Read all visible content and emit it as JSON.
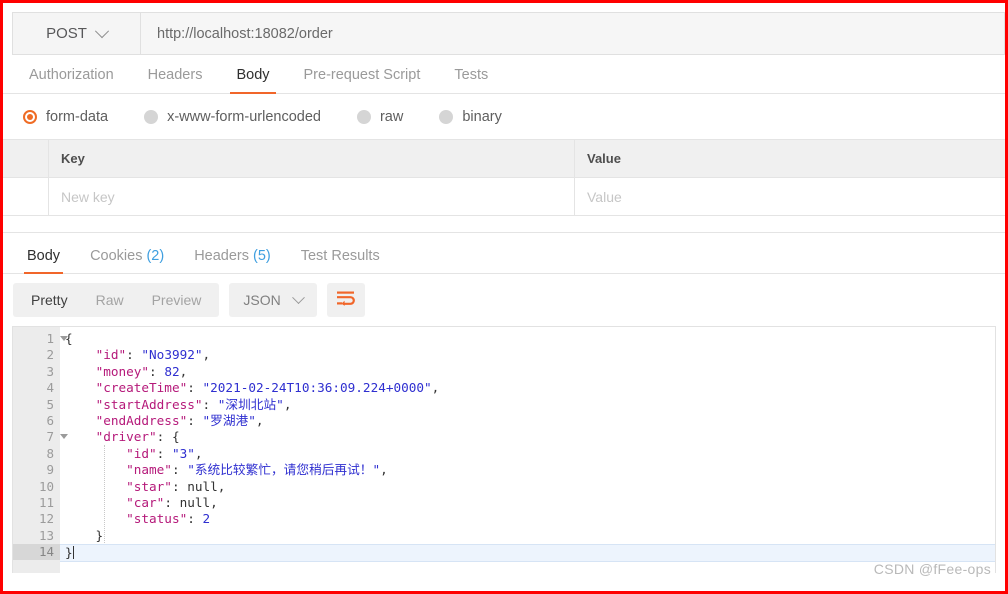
{
  "request": {
    "method": "POST",
    "url": "http://localhost:18082/order",
    "tabs": [
      {
        "label": "Authorization",
        "active": false
      },
      {
        "label": "Headers",
        "active": false
      },
      {
        "label": "Body",
        "active": true
      },
      {
        "label": "Pre-request Script",
        "active": false
      },
      {
        "label": "Tests",
        "active": false
      }
    ],
    "body_types": [
      {
        "label": "form-data",
        "selected": true
      },
      {
        "label": "x-www-form-urlencoded",
        "selected": false
      },
      {
        "label": "raw",
        "selected": false
      },
      {
        "label": "binary",
        "selected": false
      }
    ],
    "table": {
      "headers": {
        "key": "Key",
        "value": "Value"
      },
      "new_row": {
        "key_placeholder": "New key",
        "value_placeholder": "Value"
      }
    }
  },
  "response": {
    "tabs": [
      {
        "label": "Body",
        "count": "",
        "active": true
      },
      {
        "label": "Cookies",
        "count": "(2)",
        "active": false
      },
      {
        "label": "Headers",
        "count": "(5)",
        "active": false
      },
      {
        "label": "Test Results",
        "count": "",
        "active": false
      }
    ],
    "view_modes": [
      {
        "label": "Pretty",
        "active": true
      },
      {
        "label": "Raw",
        "active": false
      },
      {
        "label": "Preview",
        "active": false
      }
    ],
    "format": "JSON",
    "wrap_icon": "word-wrap-icon",
    "body_lines": [
      {
        "n": "1",
        "fold": true,
        "current": false,
        "tokens": [
          {
            "t": "pun",
            "v": "{"
          }
        ]
      },
      {
        "n": "2",
        "fold": false,
        "current": false,
        "tokens": [
          {
            "t": "pun",
            "v": "    "
          },
          {
            "t": "key",
            "v": "\"id\""
          },
          {
            "t": "pun",
            "v": ": "
          },
          {
            "t": "str",
            "v": "\"No3992\""
          },
          {
            "t": "pun",
            "v": ","
          }
        ]
      },
      {
        "n": "3",
        "fold": false,
        "current": false,
        "tokens": [
          {
            "t": "pun",
            "v": "    "
          },
          {
            "t": "key",
            "v": "\"money\""
          },
          {
            "t": "pun",
            "v": ": "
          },
          {
            "t": "num",
            "v": "82"
          },
          {
            "t": "pun",
            "v": ","
          }
        ]
      },
      {
        "n": "4",
        "fold": false,
        "current": false,
        "tokens": [
          {
            "t": "pun",
            "v": "    "
          },
          {
            "t": "key",
            "v": "\"createTime\""
          },
          {
            "t": "pun",
            "v": ": "
          },
          {
            "t": "str",
            "v": "\"2021-02-24T10:36:09.224+0000\""
          },
          {
            "t": "pun",
            "v": ","
          }
        ]
      },
      {
        "n": "5",
        "fold": false,
        "current": false,
        "tokens": [
          {
            "t": "pun",
            "v": "    "
          },
          {
            "t": "key",
            "v": "\"startAddress\""
          },
          {
            "t": "pun",
            "v": ": "
          },
          {
            "t": "str",
            "v": "\"深圳北站\""
          },
          {
            "t": "pun",
            "v": ","
          }
        ]
      },
      {
        "n": "6",
        "fold": false,
        "current": false,
        "tokens": [
          {
            "t": "pun",
            "v": "    "
          },
          {
            "t": "key",
            "v": "\"endAddress\""
          },
          {
            "t": "pun",
            "v": ": "
          },
          {
            "t": "str",
            "v": "\"罗湖港\""
          },
          {
            "t": "pun",
            "v": ","
          }
        ]
      },
      {
        "n": "7",
        "fold": true,
        "current": false,
        "tokens": [
          {
            "t": "pun",
            "v": "    "
          },
          {
            "t": "key",
            "v": "\"driver\""
          },
          {
            "t": "pun",
            "v": ": {"
          }
        ]
      },
      {
        "n": "8",
        "fold": false,
        "current": false,
        "tokens": [
          {
            "t": "pun",
            "v": "        "
          },
          {
            "t": "key",
            "v": "\"id\""
          },
          {
            "t": "pun",
            "v": ": "
          },
          {
            "t": "str",
            "v": "\"3\""
          },
          {
            "t": "pun",
            "v": ","
          }
        ]
      },
      {
        "n": "9",
        "fold": false,
        "current": false,
        "tokens": [
          {
            "t": "pun",
            "v": "        "
          },
          {
            "t": "key",
            "v": "\"name\""
          },
          {
            "t": "pun",
            "v": ": "
          },
          {
            "t": "str",
            "v": "\"系统比较繁忙，请您稍后再试！\""
          },
          {
            "t": "pun",
            "v": ","
          }
        ]
      },
      {
        "n": "10",
        "fold": false,
        "current": false,
        "tokens": [
          {
            "t": "pun",
            "v": "        "
          },
          {
            "t": "key",
            "v": "\"star\""
          },
          {
            "t": "pun",
            "v": ": "
          },
          {
            "t": "null",
            "v": "null"
          },
          {
            "t": "pun",
            "v": ","
          }
        ]
      },
      {
        "n": "11",
        "fold": false,
        "current": false,
        "tokens": [
          {
            "t": "pun",
            "v": "        "
          },
          {
            "t": "key",
            "v": "\"car\""
          },
          {
            "t": "pun",
            "v": ": "
          },
          {
            "t": "null",
            "v": "null"
          },
          {
            "t": "pun",
            "v": ","
          }
        ]
      },
      {
        "n": "12",
        "fold": false,
        "current": false,
        "tokens": [
          {
            "t": "pun",
            "v": "        "
          },
          {
            "t": "key",
            "v": "\"status\""
          },
          {
            "t": "pun",
            "v": ": "
          },
          {
            "t": "num",
            "v": "2"
          }
        ]
      },
      {
        "n": "13",
        "fold": false,
        "current": false,
        "tokens": [
          {
            "t": "pun",
            "v": "    }"
          }
        ]
      },
      {
        "n": "14",
        "fold": false,
        "current": true,
        "tokens": [
          {
            "t": "pun",
            "v": "}"
          }
        ]
      }
    ]
  },
  "watermark": "CSDN @fFee-ops",
  "colors": {
    "accent": "#f1662a",
    "border_highlight": "#ff0000",
    "json_key": "#a31515",
    "json_string": "#2f2fd0",
    "link_count": "#3f9fe0"
  }
}
